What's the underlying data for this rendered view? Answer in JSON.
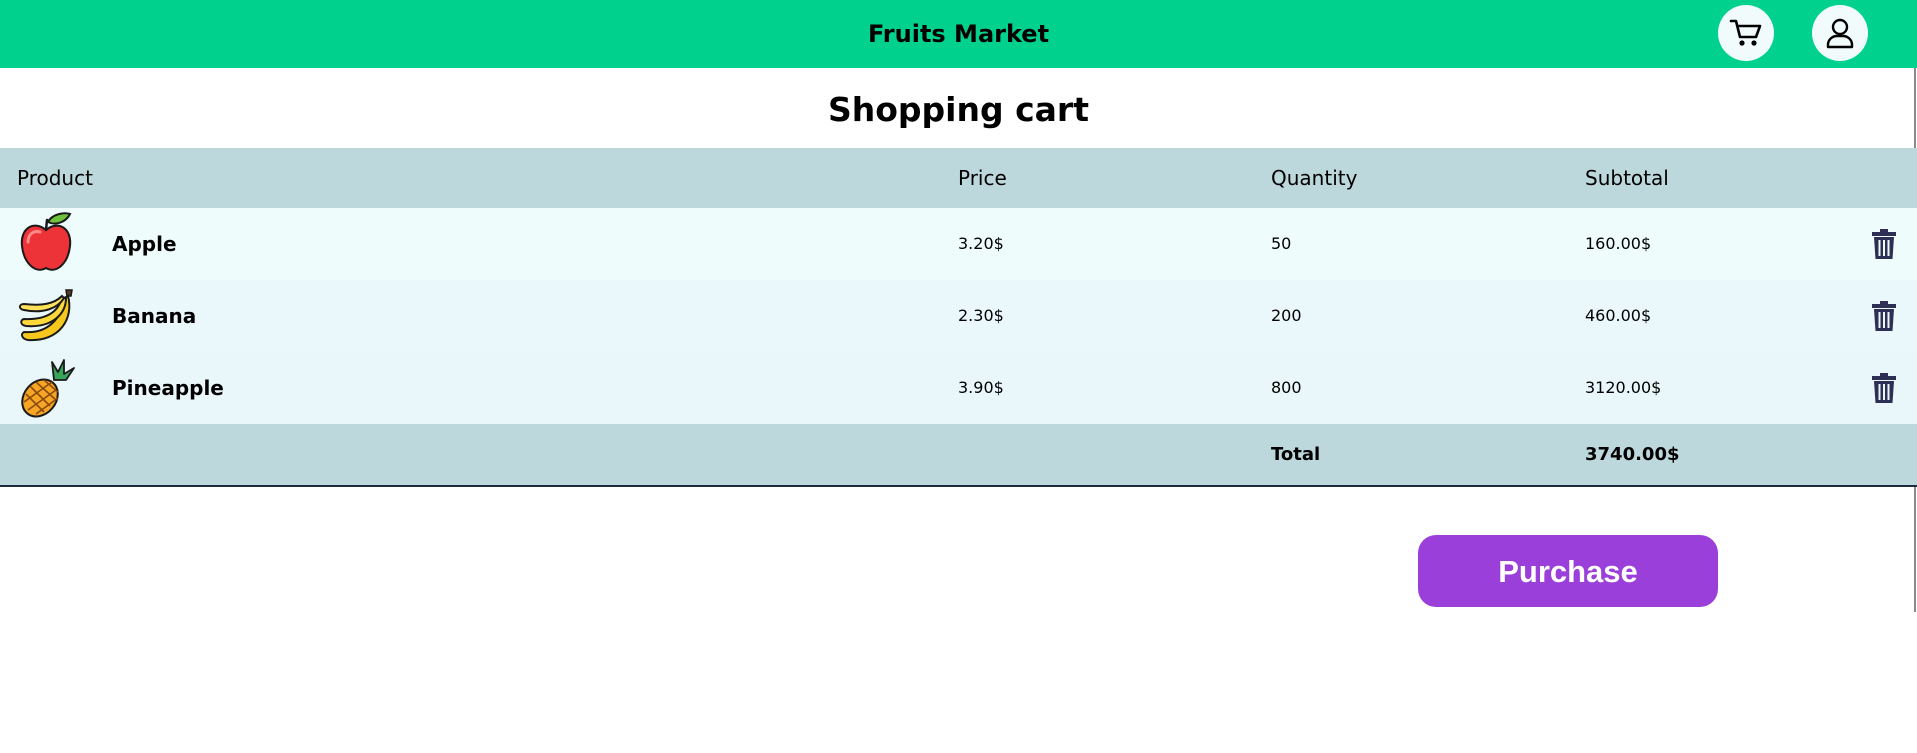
{
  "header": {
    "brand": "Fruits Market",
    "cart_icon": "shopping-cart-icon",
    "user_icon": "user-icon",
    "bg_color": "#00d18c"
  },
  "page": {
    "title": "Shopping cart"
  },
  "table": {
    "columns": {
      "product": "Product",
      "price": "Price",
      "quantity": "Quantity",
      "subtotal": "Subtotal"
    },
    "rows": [
      {
        "name": "Apple",
        "icon": "apple-icon",
        "price": "3.20$",
        "quantity": "50",
        "subtotal": "160.00$"
      },
      {
        "name": "Banana",
        "icon": "banana-icon",
        "price": "2.30$",
        "quantity": "200",
        "subtotal": "460.00$"
      },
      {
        "name": "Pineapple",
        "icon": "pineapple-icon",
        "price": "3.90$",
        "quantity": "800",
        "subtotal": "3120.00$"
      }
    ],
    "delete_icon": "trash-icon",
    "footer": {
      "total_label": "Total",
      "total_value": "3740.00$"
    },
    "header_bg": "#bdd8dc"
  },
  "actions": {
    "purchase_label": "Purchase",
    "purchase_color": "#9b3fdb"
  }
}
